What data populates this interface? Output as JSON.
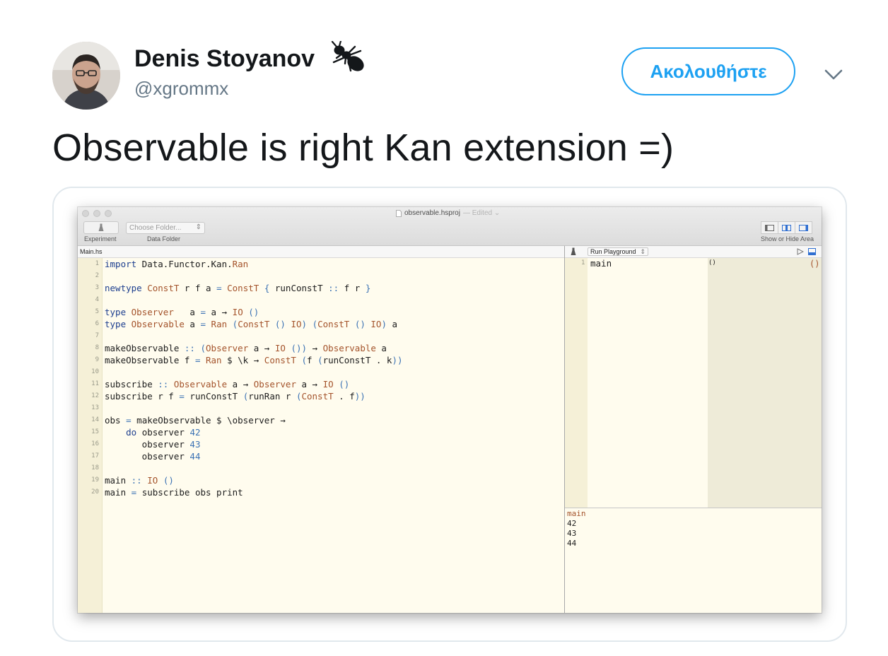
{
  "tweet": {
    "author_name": "Denis Stoyanov",
    "author_handle": "@xgrommx",
    "badge_icon": "ant-icon",
    "follow_label": "Ακολουθήστε",
    "text": "Observable is right Kan extension =)",
    "colors": {
      "follow": "#1da1f2",
      "handle": "#657786",
      "text": "#14171a"
    }
  },
  "window": {
    "title": "observable.hsproj",
    "edited": "— Edited ⌄",
    "toolbar": {
      "experiment_label": "Experiment",
      "folder_placeholder": "Choose Folder...",
      "folder_label": "Data Folder",
      "view_label": "Show or Hide Area"
    },
    "file_tab": "Main.hs",
    "playground_select": "Run Playground",
    "code_lines": [
      {
        "n": "1",
        "t": "import Data.Functor.Kan.Ran"
      },
      {
        "n": "2",
        "t": ""
      },
      {
        "n": "3",
        "t": "newtype ConstT r f a = ConstT { runConstT :: f r }"
      },
      {
        "n": "4",
        "t": ""
      },
      {
        "n": "5",
        "t": "type Observer   a = a → IO ()"
      },
      {
        "n": "6",
        "t": "type Observable a = Ran (ConstT () IO) (ConstT () IO) a"
      },
      {
        "n": "7",
        "t": ""
      },
      {
        "n": "8",
        "t": "makeObservable :: (Observer a → IO ()) → Observable a"
      },
      {
        "n": "9",
        "t": "makeObservable f = Ran $ \\k → ConstT (f (runConstT . k))"
      },
      {
        "n": "10",
        "t": ""
      },
      {
        "n": "11",
        "t": "subscribe :: Observable a → Observer a → IO ()"
      },
      {
        "n": "12",
        "t": "subscribe r f = runConstT (runRan r (ConstT . f))"
      },
      {
        "n": "13",
        "t": ""
      },
      {
        "n": "14",
        "t": "obs = makeObservable $ \\observer →"
      },
      {
        "n": "15",
        "t": "    do observer 42"
      },
      {
        "n": "16",
        "t": "       observer 43"
      },
      {
        "n": "17",
        "t": "       observer 44"
      },
      {
        "n": "18",
        "t": ""
      },
      {
        "n": "19",
        "t": "main :: IO ()"
      },
      {
        "n": "20",
        "t": "main = subscribe obs print"
      }
    ],
    "playground": {
      "line_number": "1",
      "code": "main",
      "inline_value": "()",
      "result_value": "()"
    },
    "output": {
      "header": "main",
      "lines": [
        "42",
        "43",
        "44"
      ]
    }
  }
}
